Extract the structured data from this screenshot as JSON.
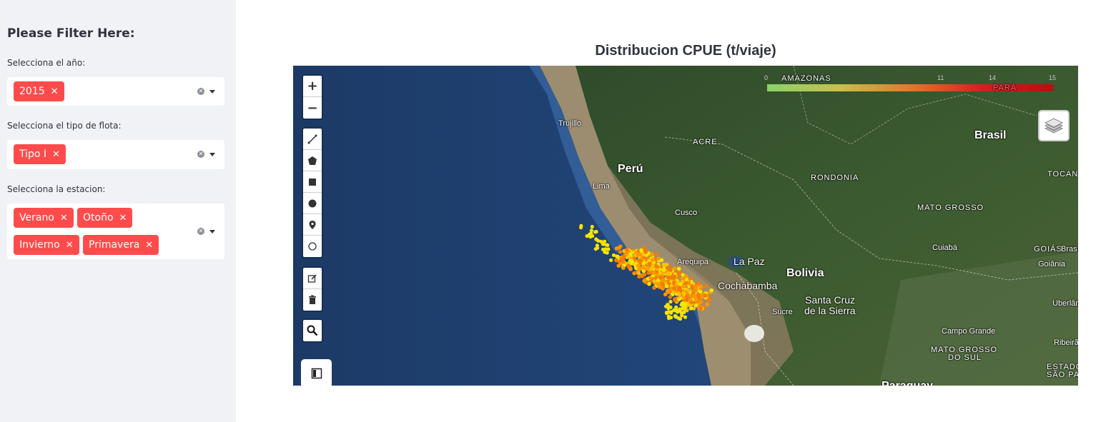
{
  "sidebar": {
    "title": "Please Filter Here:",
    "filters": [
      {
        "label": "Selecciona el año:",
        "tags": [
          "2015"
        ]
      },
      {
        "label": "Selecciona el tipo de flota:",
        "tags": [
          "Tipo I"
        ]
      },
      {
        "label": "Selecciona la estacion:",
        "tags": [
          "Verano",
          "Otoño",
          "Invierno",
          "Primavera"
        ]
      }
    ],
    "accent_color": "#ff4b4b",
    "background_color": "#f0f2f6"
  },
  "map": {
    "title": "Distribucion CPUE (t/viaje)",
    "colorbar": {
      "ticks": [
        "0",
        "11",
        "14",
        "15"
      ],
      "colors": [
        "#8ad26b",
        "#c8c04a",
        "#e07a2a",
        "#d32020",
        "#b70f0f"
      ]
    },
    "controls": {
      "zoom_in": "+",
      "zoom_out": "−",
      "draw_tools": [
        "polyline-icon",
        "polygon-icon",
        "rectangle-icon",
        "circle-icon",
        "marker-icon",
        "circlemarker-icon"
      ],
      "edit_tools": [
        "edit-icon",
        "delete-icon"
      ],
      "search": "search-icon",
      "measure": "measure-icon",
      "layers": "layers-icon"
    },
    "labels": {
      "amazonas": "AMAZONAS",
      "para": "PARÁ",
      "trujillo": "Trujillo",
      "acre": "ACRE",
      "brasil": "Brasil",
      "peru": "Perú",
      "rondonia": "RONDONIA",
      "tocan": "TOCAN",
      "lima": "Lima",
      "cusco": "Cusco",
      "mato_grosso": "MATO GROSSO",
      "cuiaba": "Cuiabá",
      "goias": "GOIÁS",
      "bras": "Bras",
      "goiania": "Goiânia",
      "arequipa": "Arequipa",
      "la_paz": "La Paz",
      "bolivia": "Bolivia",
      "cochabamba": "Cochabamba",
      "santa_cruz_1": "Santa Cruz",
      "santa_cruz_2": "de la Sierra",
      "sucre": "Sucre",
      "uberlan": "Uberlân",
      "campo_grande": "Campo Grande",
      "ribeira": "Ribeirã",
      "mato_grosso_sul_1": "MATO GROSSO",
      "mato_grosso_sul_2": "DO SUL",
      "estado_de_1": "ESTADO DE",
      "estado_de_2": "SÃO PAUL",
      "paraguay": "Paraguay"
    },
    "points_color_scale": [
      "#f5e400",
      "#ffc107",
      "#ff9800",
      "#f57c00",
      "#e65100"
    ]
  }
}
